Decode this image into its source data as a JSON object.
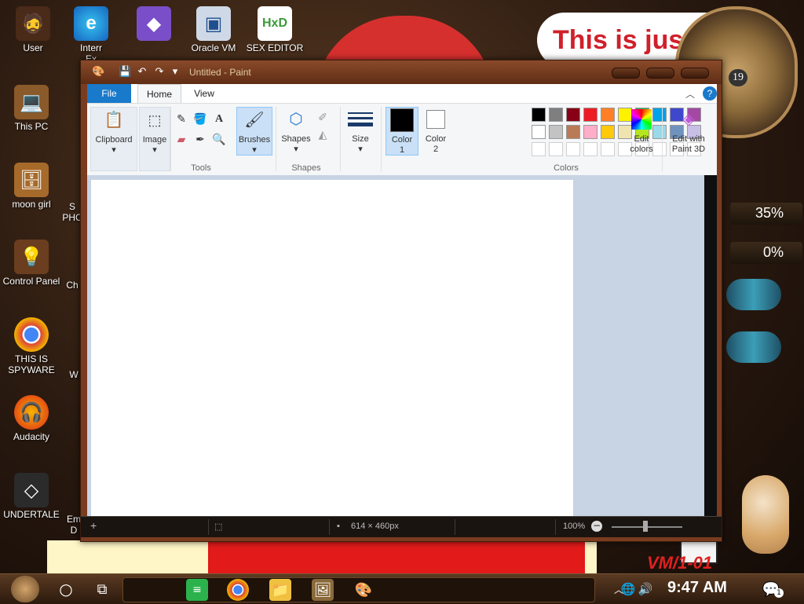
{
  "desktop": {
    "icons": [
      {
        "label": "User",
        "glyph": "🧔"
      },
      {
        "label": "Interr\nEx",
        "glyph": "e"
      },
      {
        "label": "",
        "glyph": "◆"
      },
      {
        "label": "Oracle VM",
        "glyph": "▣"
      },
      {
        "label": "SEX EDITOR",
        "glyph": "HxD"
      },
      {
        "label": "This PC",
        "glyph": "💻"
      },
      {
        "label": "moon girl",
        "glyph": "🗄"
      },
      {
        "label": "Control Panel",
        "glyph": "💡"
      },
      {
        "label": "THIS IS\nSPYWARE",
        "glyph": "◉"
      },
      {
        "label": "Audacity",
        "glyph": "🎧"
      },
      {
        "label": "UNDERTALE",
        "glyph": "◇"
      },
      {
        "label": "S\nPHC",
        "glyph": ""
      },
      {
        "label": "Ch",
        "glyph": ""
      },
      {
        "label": "W",
        "glyph": ""
      },
      {
        "label": "Em\nD",
        "glyph": ""
      }
    ],
    "banner_text": "This is jus",
    "clock_number": "19",
    "gauge1": "35%",
    "gauge2": "0%",
    "vm_text": "VM/1-01"
  },
  "paint": {
    "title": "Untitled - Paint",
    "quick_access": [
      "paint-icon",
      "save-icon",
      "undo-icon",
      "redo-icon",
      "customize-icon"
    ],
    "tabs": {
      "file": "File",
      "home": "Home",
      "view": "View"
    },
    "ribbon": {
      "clipboard": "Clipboard",
      "image": "Image",
      "tools_group": "Tools",
      "brushes": "Brushes",
      "shapes": "Shapes",
      "shapes_group": "Shapes",
      "size": "Size",
      "color1_a": "Color",
      "color1_b": "1",
      "color2_a": "Color",
      "color2_b": "2",
      "colors_group": "Colors",
      "edit_colors_a": "Edit",
      "edit_colors_b": "colors",
      "paint3d_a": "Edit with",
      "paint3d_b": "Paint 3D"
    },
    "palette_row1": [
      "#000000",
      "#7f7f7f",
      "#880015",
      "#ed1c24",
      "#ff7f27",
      "#fff200",
      "#22b14c",
      "#00a2e8",
      "#3f48cc",
      "#a349a4"
    ],
    "palette_row2": [
      "#ffffff",
      "#c3c3c3",
      "#b97a57",
      "#ffaec9",
      "#ffc90e",
      "#efe4b0",
      "#b5e61d",
      "#99d9ea",
      "#7092be",
      "#c8bfe7"
    ],
    "status": {
      "dimensions": "614 × 460px",
      "zoom": "100%"
    }
  },
  "taskbar": {
    "time": "9:47 AM",
    "notification_count": "1"
  }
}
